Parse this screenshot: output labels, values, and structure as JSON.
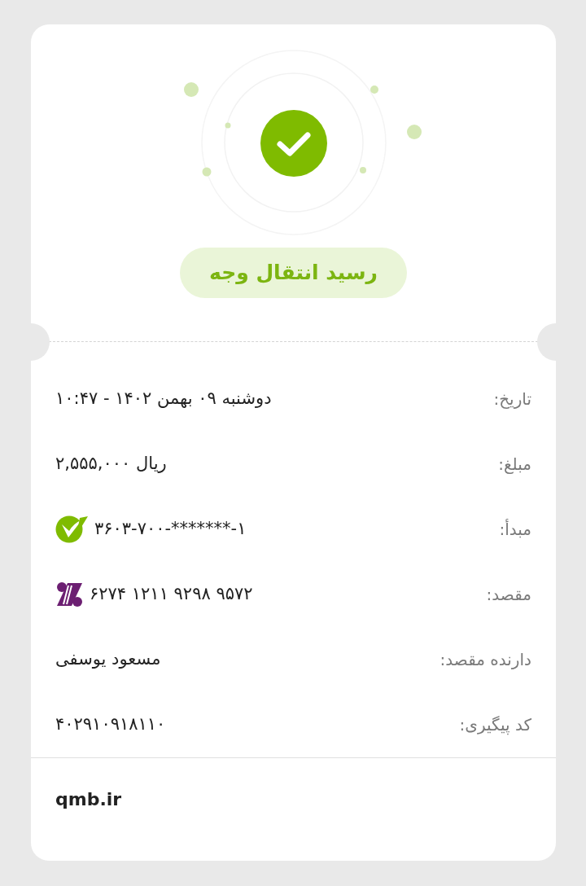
{
  "title": "رسید انتقال وجه",
  "rows": [
    {
      "kind": "text",
      "label": "تاریخ:",
      "value": "دوشنبه ۰۹ بهمن ۱۴۰۲ - ۱۰:۴۷"
    },
    {
      "kind": "amount",
      "label": "مبلغ:",
      "value": "۲,۵۵۵,۰۰۰ ریال"
    },
    {
      "kind": "account",
      "label": "مبدأ:",
      "value": "۳۶۰۳-۷۰۰-*******-۱"
    },
    {
      "kind": "card",
      "label": "مقصد:",
      "value": "۶۲۷۴ ۱۲۱۱ ۹۲۹۸ ۹۵۷۲"
    },
    {
      "kind": "text",
      "label": "دارنده مقصد:",
      "value": "مسعود یوسفی"
    },
    {
      "kind": "text",
      "label": "کد پیگیری:",
      "value": "۴۰۲۹۱۰۹۱۸۱۱۰"
    }
  ],
  "footer": "qmb.ir"
}
